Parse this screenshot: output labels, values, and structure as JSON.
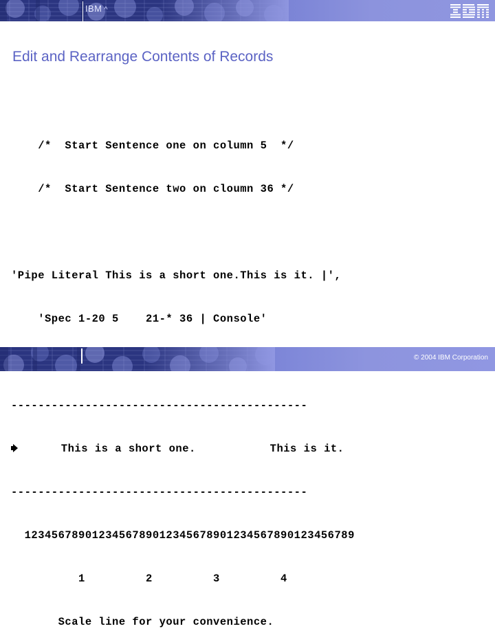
{
  "header": {
    "brand": "IBM",
    "caret": "^",
    "logo_alt": "ibm-logo"
  },
  "title": "Edit and Rearrange Contents of Records",
  "code": {
    "line1": "    /*  Start Sentence one on column 5  */",
    "line2": "    /*  Start Sentence two on cloumn 36 */",
    "line3": "'Pipe Literal This is a short one.This is it. |',",
    "line4": "    'Spec 1-20 5    21-* 36 | Console'",
    "divider_top": "--------------------------------------------",
    "result_row": "      This is a short one.           This is it.",
    "divider_bottom": "--------------------------------------------",
    "ruler": "  1234567890123456789012345678901234567890123456789",
    "tens": "          1         2         3         4",
    "scale_caption": "       Scale line for your convenience."
  },
  "footer": {
    "copyright": "© 2004 IBM Corporation"
  },
  "colors": {
    "title": "#5b63c4",
    "header_dark": "#2e3a8c",
    "header_light": "#8f96e0",
    "code_text": "#000000"
  }
}
